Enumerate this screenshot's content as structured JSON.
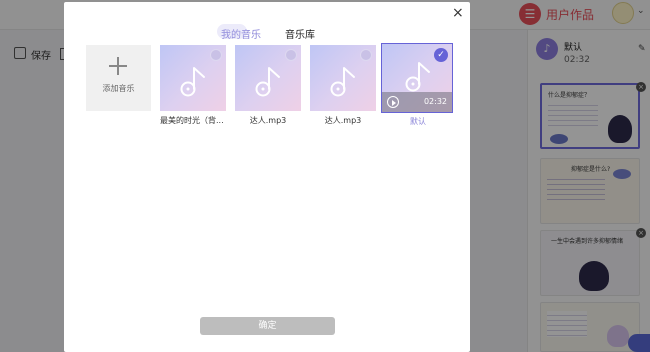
{
  "app": {
    "header": {
      "works_label": "用户作品"
    },
    "toolbar": {
      "save_label": "保存"
    },
    "audio": {
      "name": "默认",
      "time": "02:32"
    },
    "slides": [
      {
        "title": "什么是抑郁症？"
      },
      {
        "title": "抑郁症是什么?"
      },
      {
        "title": "一生中会遇到许多抑郁情绪"
      },
      {
        "title": ""
      }
    ]
  },
  "modal": {
    "tabs": [
      "我的音乐",
      "音乐库"
    ],
    "add_label": "添加音乐",
    "music": [
      {
        "label": "最美的时光（背...",
        "selected": false
      },
      {
        "label": "达人.mp3",
        "selected": false
      },
      {
        "label": "达人.mp3",
        "selected": false
      },
      {
        "label": "默认",
        "selected": true,
        "duration": "02:32"
      }
    ],
    "confirm_label": "确定",
    "close_symbol": "×",
    "check_symbol": "✓"
  },
  "colors": {
    "accent": "#6663d7",
    "tab_active": "#8a84d8",
    "brand_red": "#e8505b",
    "button_disabled": "#bdbdbd"
  }
}
